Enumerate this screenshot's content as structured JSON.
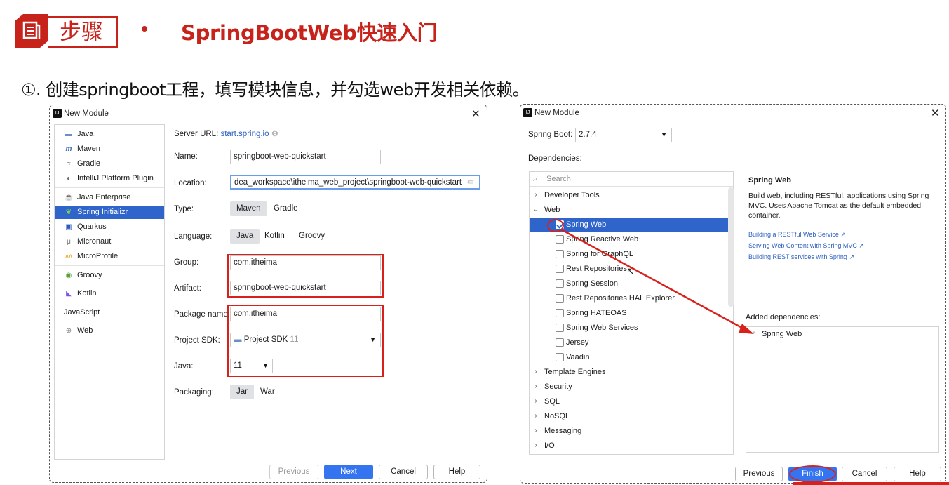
{
  "header": {
    "section_label": "步骤",
    "title": "SpringBootWeb快速入门",
    "step_text": "①. 创建springboot工程，填写模块信息，并勾选web开发相关依赖。"
  },
  "dialog1": {
    "title": "New Module",
    "generators": [
      {
        "label": "Java",
        "icon": "java-folder-icon"
      },
      {
        "label": "Maven",
        "icon": "maven-icon"
      },
      {
        "label": "Gradle",
        "icon": "gradle-icon"
      },
      {
        "label": "IntelliJ Platform Plugin",
        "icon": "plugin-icon"
      },
      {
        "label": "Java Enterprise",
        "icon": "java-enterprise-icon"
      },
      {
        "label": "Spring Initializr",
        "icon": "spring-icon",
        "selected": true
      },
      {
        "label": "Quarkus",
        "icon": "quarkus-icon"
      },
      {
        "label": "Micronaut",
        "icon": "micronaut-icon"
      },
      {
        "label": "MicroProfile",
        "icon": "microprofile-icon"
      },
      {
        "label": "Groovy",
        "icon": "groovy-icon"
      },
      {
        "label": "Kotlin",
        "icon": "kotlin-icon"
      },
      {
        "label": "JavaScript",
        "icon": ""
      },
      {
        "label": "Web",
        "icon": "web-icon"
      }
    ],
    "server_url_label": "Server URL:",
    "server_url_value": "start.spring.io",
    "name_label": "Name:",
    "name_value": "springboot-web-quickstart",
    "location_label": "Location:",
    "location_value": "dea_workspace\\itheima_web_project\\springboot-web-quickstart",
    "type_label": "Type:",
    "type_options": [
      "Maven",
      "Gradle"
    ],
    "language_label": "Language:",
    "language_options": [
      "Java",
      "Kotlin",
      "Groovy"
    ],
    "group_label": "Group:",
    "group_value": "com.itheima",
    "artifact_label": "Artifact:",
    "artifact_value": "springboot-web-quickstart",
    "package_label": "Package name:",
    "package_value": "com.itheima",
    "sdk_label": "Project SDK:",
    "sdk_value": "Project SDK",
    "sdk_version": "11",
    "java_label": "Java:",
    "java_value": "11",
    "packaging_label": "Packaging:",
    "packaging_options": [
      "Jar",
      "War"
    ],
    "buttons": {
      "previous": "Previous",
      "next": "Next",
      "cancel": "Cancel",
      "help": "Help"
    }
  },
  "dialog2": {
    "title": "New Module",
    "spring_boot_label": "Spring Boot:",
    "spring_boot_value": "2.7.4",
    "dependencies_label": "Dependencies:",
    "search_placeholder": "Search",
    "tree": [
      {
        "label": "Developer Tools",
        "kind": "group",
        "expanded": false
      },
      {
        "label": "Web",
        "kind": "group",
        "expanded": true
      },
      {
        "label": "Spring Web",
        "kind": "dep",
        "checked": true,
        "selected": true
      },
      {
        "label": "Spring Reactive Web",
        "kind": "dep",
        "checked": false
      },
      {
        "label": "Spring for GraphQL",
        "kind": "dep",
        "checked": false
      },
      {
        "label": "Rest Repositories",
        "kind": "dep",
        "checked": false
      },
      {
        "label": "Spring Session",
        "kind": "dep",
        "checked": false
      },
      {
        "label": "Rest Repositories HAL Explorer",
        "kind": "dep",
        "checked": false
      },
      {
        "label": "Spring HATEOAS",
        "kind": "dep",
        "checked": false
      },
      {
        "label": "Spring Web Services",
        "kind": "dep",
        "checked": false
      },
      {
        "label": "Jersey",
        "kind": "dep",
        "checked": false
      },
      {
        "label": "Vaadin",
        "kind": "dep",
        "checked": false
      },
      {
        "label": "Template Engines",
        "kind": "group",
        "expanded": false
      },
      {
        "label": "Security",
        "kind": "group",
        "expanded": false
      },
      {
        "label": "SQL",
        "kind": "group",
        "expanded": false
      },
      {
        "label": "NoSQL",
        "kind": "group",
        "expanded": false
      },
      {
        "label": "Messaging",
        "kind": "group",
        "expanded": false
      },
      {
        "label": "I/O",
        "kind": "group",
        "expanded": false
      }
    ],
    "detail_title": "Spring Web",
    "detail_desc": "Build web, including RESTful, applications using Spring MVC. Uses Apache Tomcat as the default embedded container.",
    "detail_links": [
      "Building a RESTful Web Service ↗",
      "Serving Web Content with Spring MVC ↗",
      "Building REST services with Spring ↗"
    ],
    "added_label": "Added dependencies:",
    "added_items": [
      "Spring Web"
    ],
    "buttons": {
      "previous": "Previous",
      "finish": "Finish",
      "cancel": "Cancel",
      "help": "Help"
    }
  },
  "colors": {
    "accent_red": "#c7231b",
    "annotation_red": "#d9211b",
    "selection_blue": "#2f65ca",
    "primary_button": "#3574f0"
  }
}
